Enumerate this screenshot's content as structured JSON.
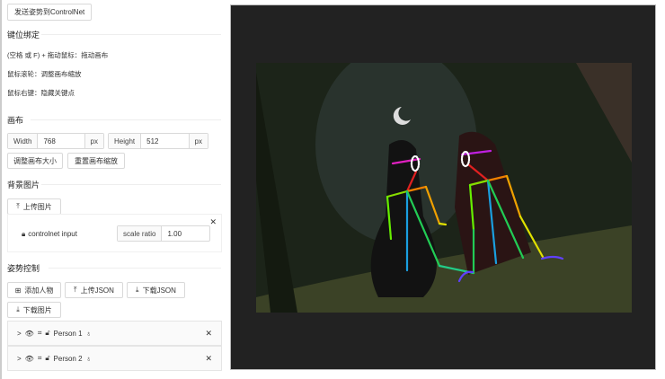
{
  "send_button": "发送姿势到ControlNet",
  "keybind": {
    "title": "键位绑定",
    "lines": [
      "(空格 或 F) + 拖动鼠标：拖动画布",
      "鼠标滚轮：调整画布缩放",
      "鼠标右键：隐藏关键点"
    ]
  },
  "canvas": {
    "title": "画布",
    "width_label": "Width",
    "width_value": "768",
    "height_label": "Height",
    "height_value": "512",
    "unit": "px",
    "resize_button": "调整画布大小",
    "reset_zoom_button": "重置画布缩放"
  },
  "background": {
    "title": "背景图片",
    "upload_button": "上传图片",
    "layer_name": "controlnet input",
    "scale_label": "scale ratio",
    "scale_value": "1.00"
  },
  "pose": {
    "title": "姿势控制",
    "add_person": "添加人物",
    "upload_json": "上传JSON",
    "download_json": "下载JSON",
    "download_image": "下载图片",
    "persons": [
      {
        "name": "Person 1"
      },
      {
        "name": "Person 2"
      }
    ]
  }
}
